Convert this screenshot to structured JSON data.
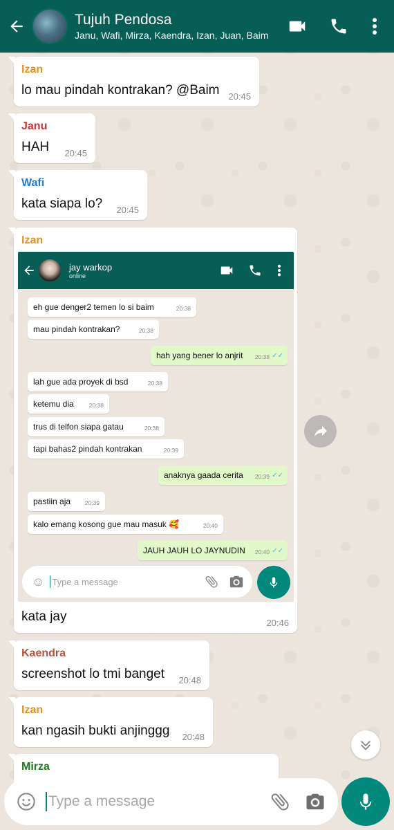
{
  "colors": {
    "header_bg": "#075e54",
    "accent_teal": "#00897b",
    "outgoing_bubble": "#e1f8c9",
    "read_ticks": "#4fb6ec",
    "sender_izan": "#e8911a",
    "sender_janu": "#d32f2f",
    "sender_wafi": "#1f7ad1",
    "sender_kaendra": "#b5543b",
    "sender_mirza": "#1c7a1c"
  },
  "header": {
    "title": "Tujuh Pendosa",
    "members": "Janu, Wafi, Mirza, Kaendra, Izan, Juan, Baim",
    "icons": [
      "back-arrow-icon",
      "video-call-icon",
      "voice-call-icon",
      "more-vertical-icon"
    ]
  },
  "messages": [
    {
      "sender": "Izan",
      "text": "lo mau pindah kontrakan? @Baim",
      "time": "20:45"
    },
    {
      "sender": "Janu",
      "text": "HAH",
      "time": "20:45"
    },
    {
      "sender": "Wafi",
      "text": "kata siapa lo?",
      "time": "20:45"
    },
    {
      "sender": "Izan",
      "text": "kata jay",
      "time": "20:46"
    },
    {
      "sender": "Kaendra",
      "text": "screenshot lo tmi banget",
      "time": "20:48"
    },
    {
      "sender": "Izan",
      "text": "kan ngasih bukti anjinggg",
      "time": "20:48"
    },
    {
      "sender": "Mirza"
    }
  ],
  "screenshot": {
    "contact_name": "jay warkop",
    "status": "online",
    "messages": [
      {
        "text": "eh gue denger2 temen lo si baim",
        "time": "20:38",
        "outgoing": false
      },
      {
        "text": "mau pindah kontrakan?",
        "time": "20:38",
        "outgoing": false
      },
      {
        "text": "hah yang bener lo anjrit",
        "time": "20:38",
        "outgoing": true
      },
      {
        "text": "lah gue ada proyek di bsd",
        "time": "20:38",
        "outgoing": false
      },
      {
        "text": "ketemu dia",
        "time": "20:38",
        "outgoing": false
      },
      {
        "text": "trus di telfon siapa gatau",
        "time": "20:38",
        "outgoing": false
      },
      {
        "text": "tapi bahas2 pindah kontrakan",
        "time": "20:39",
        "outgoing": false
      },
      {
        "text": "anaknya gaada cerita",
        "time": "20:39",
        "outgoing": true
      },
      {
        "text": "pastiin aja",
        "time": "20:39",
        "outgoing": false
      },
      {
        "text": "kalo emang kosong gue mau masuk 🥰",
        "time": "20:40",
        "outgoing": false
      },
      {
        "text": "JAUH JAUH LO JAYNUDIN",
        "time": "20:40",
        "outgoing": true
      }
    ],
    "input_placeholder": "Type a message"
  },
  "input": {
    "placeholder": "Type a message"
  }
}
